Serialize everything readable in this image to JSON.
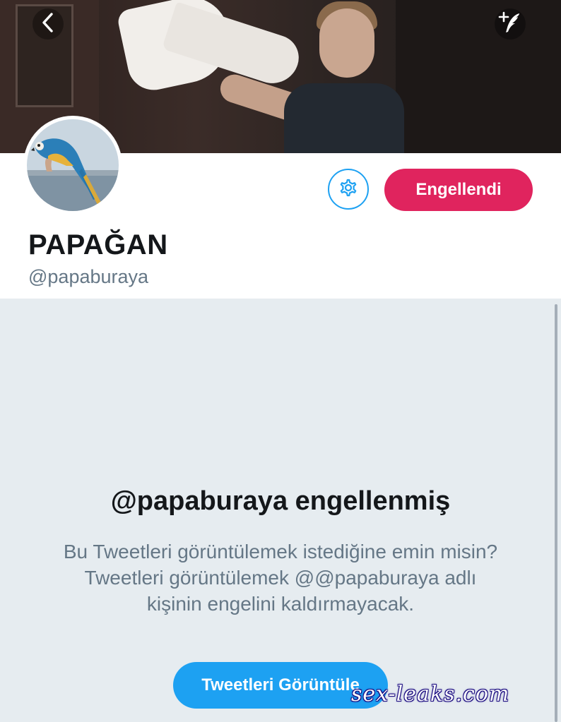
{
  "profile": {
    "display_name": "PAPAĞAN",
    "handle": "@papaburaya",
    "blocked_button_label": "Engellendi"
  },
  "icons": {
    "back": "chevron-left-icon",
    "compose": "compose-tweet-icon",
    "settings": "gear-icon"
  },
  "blocked_notice": {
    "title": "@papaburaya engellenmiş",
    "description": "Bu Tweetleri görüntülemek istediğine emin misin? Tweetleri görüntülemek @@papaburaya adlı kişinin engelini kaldırmayacak.",
    "view_button_label": "Tweetleri Görüntüle"
  },
  "watermark": "sex-leaks.com",
  "colors": {
    "accent_blue": "#1da1f2",
    "blocked_red": "#e0245e",
    "panel_background": "#e6ecf0",
    "secondary_text": "#657786"
  }
}
